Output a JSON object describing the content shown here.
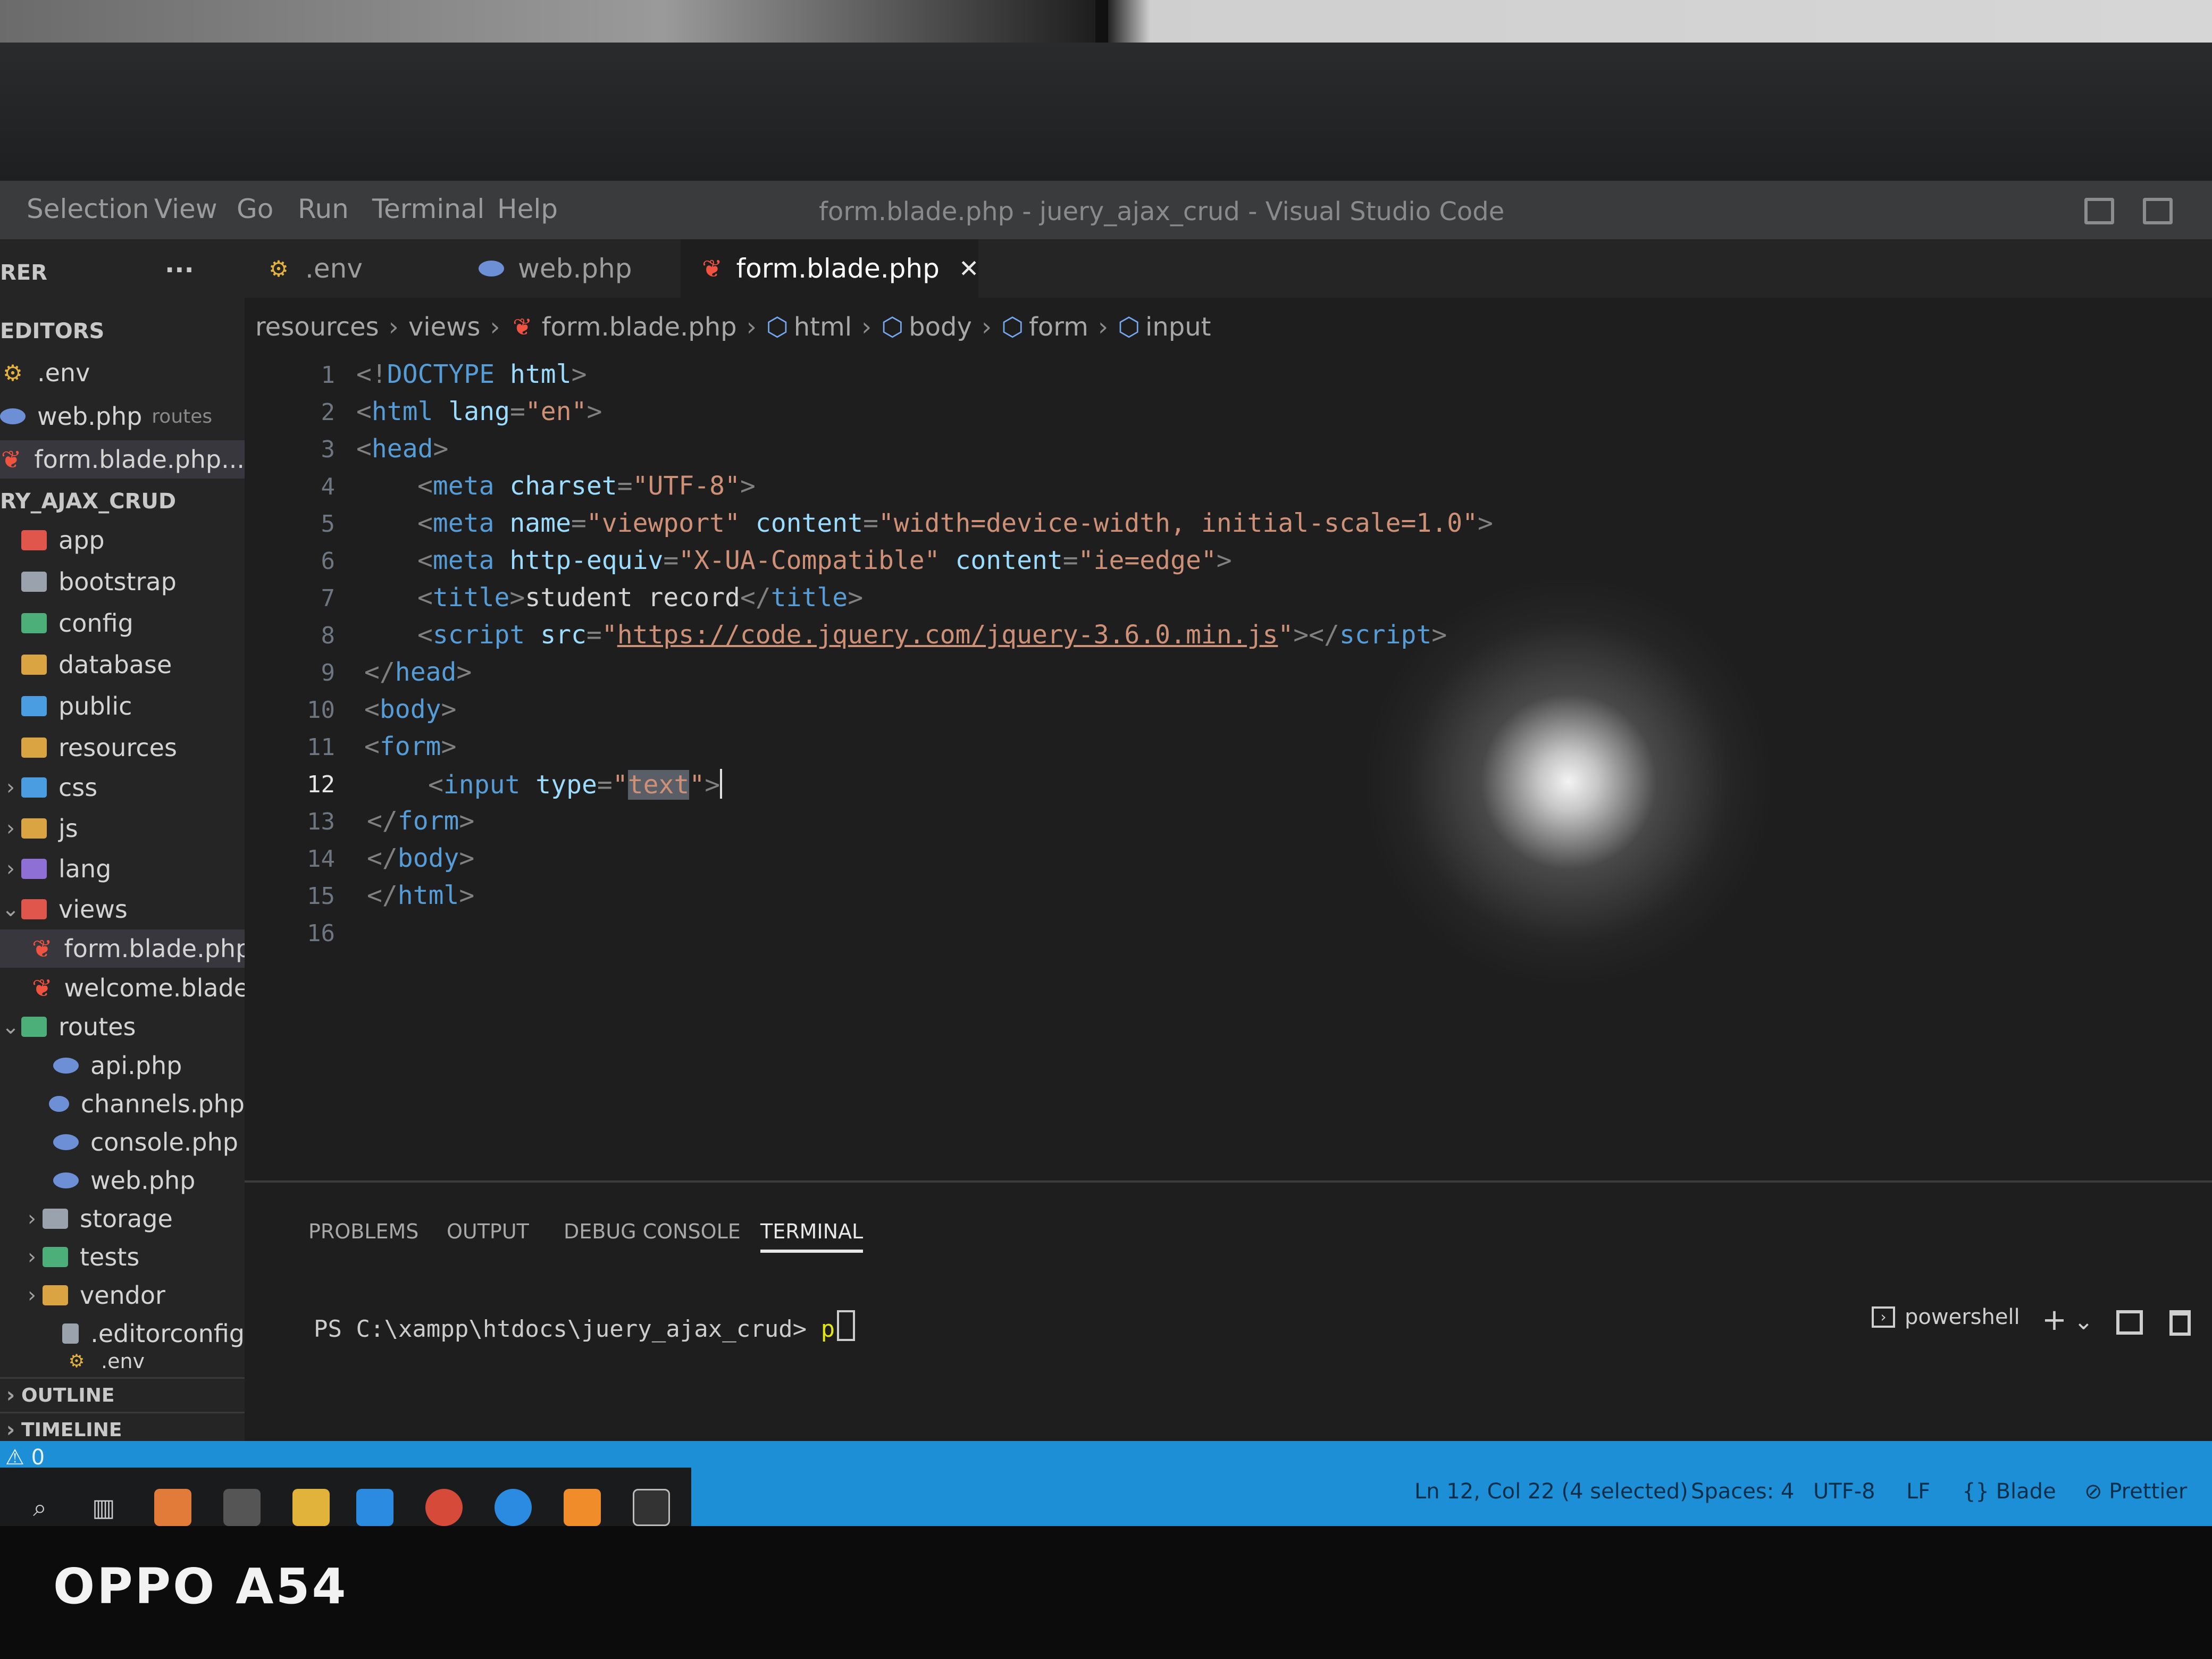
{
  "watermark": "OPPO A54",
  "menu": [
    "Selection",
    "View",
    "Go",
    "Run",
    "Terminal",
    "Help"
  ],
  "window_title": "form.blade.php - juery_ajax_crud - Visual Studio Code",
  "sidebar": {
    "explorer_label": "RER",
    "more": "···",
    "open_editors_label": "EDITORS",
    "open_editors": [
      {
        "name": ".env",
        "detail": ""
      },
      {
        "name": "web.php",
        "detail": "routes"
      },
      {
        "name": "form.blade.php...",
        "detail": ""
      }
    ],
    "project_label": "RY_AJAX_CRUD",
    "tree": [
      {
        "label": "app",
        "chev": ""
      },
      {
        "label": "bootstrap",
        "chev": ""
      },
      {
        "label": "config",
        "chev": ""
      },
      {
        "label": "database",
        "chev": ""
      },
      {
        "label": "public",
        "chev": ""
      },
      {
        "label": "resources",
        "chev": ""
      },
      {
        "label": "css",
        "chev": "›"
      },
      {
        "label": "js",
        "chev": "›"
      },
      {
        "label": "lang",
        "chev": "›"
      },
      {
        "label": "views",
        "chev": "⌄"
      },
      {
        "label": "form.blade.php",
        "chev": ""
      },
      {
        "label": "welcome.blade....",
        "chev": ""
      },
      {
        "label": "routes",
        "chev": "⌄"
      },
      {
        "label": "api.php",
        "chev": ""
      },
      {
        "label": "channels.php",
        "chev": ""
      },
      {
        "label": "console.php",
        "chev": ""
      },
      {
        "label": "web.php",
        "chev": ""
      },
      {
        "label": "storage",
        "chev": "›"
      },
      {
        "label": "tests",
        "chev": "›"
      },
      {
        "label": "vendor",
        "chev": "›"
      },
      {
        "label": ".editorconfig",
        "chev": ""
      },
      {
        "label": ".env",
        "chev": ""
      }
    ],
    "outline_label": "OUTLINE",
    "timeline_label": "TIMELINE"
  },
  "tabs": [
    {
      "label": ".env"
    },
    {
      "label": "web.php"
    },
    {
      "label": "form.blade.php",
      "close": "✕"
    }
  ],
  "breadcrumb": [
    "resources",
    "views",
    "form.blade.php",
    "html",
    "body",
    "form",
    "input"
  ],
  "line_numbers": [
    "1",
    "2",
    "3",
    "4",
    "5",
    "6",
    "7",
    "8",
    "9",
    "10",
    "11",
    "12",
    "13",
    "14",
    "15",
    "16"
  ],
  "code": {
    "l1": {
      "p1": "<!",
      "t1": "DOCTYPE",
      "a1": " html",
      "p2": ">"
    },
    "l2": {
      "p1": "<",
      "t1": "html",
      "a1": " lang",
      "p2": "=",
      "s1": "\"en\"",
      "p3": ">"
    },
    "l3": {
      "p1": "<",
      "t1": "head",
      "p2": ">"
    },
    "l4": {
      "p1": "<",
      "t1": "meta",
      "a1": " charset",
      "p2": "=",
      "s1": "\"UTF-8\"",
      "p3": ">"
    },
    "l5": {
      "p1": "<",
      "t1": "meta",
      "a1": " name",
      "p2": "=",
      "s1": "\"viewport\"",
      "a2": " content",
      "p3": "=",
      "s2": "\"width=device-width, initial-scale=1.0\"",
      "p4": ">"
    },
    "l6": {
      "p1": "<",
      "t1": "meta",
      "a1": " http-equiv",
      "p2": "=",
      "s1": "\"X-UA-Compatible\"",
      "a2": " content",
      "p3": "=",
      "s2": "\"ie=edge\"",
      "p4": ">"
    },
    "l7": {
      "p1": "<",
      "t1": "title",
      "p2": ">",
      "tx": "student record",
      "p3": "</",
      "t2": "title",
      "p4": ">"
    },
    "l8": {
      "p1": "<",
      "t1": "script",
      "a1": " src",
      "p2": "=",
      "q1": "\"",
      "url": "https://code.jquery.com/jquery-3.6.0.min.js",
      "q2": "\"",
      "p3": "></",
      "t2": "script",
      "p4": ">"
    },
    "l9": {
      "p1": "</",
      "t1": "head",
      "p2": ">"
    },
    "l10": {
      "p1": "<",
      "t1": "body",
      "p2": ">"
    },
    "l11": {
      "p1": "<",
      "t1": "form",
      "p2": ">"
    },
    "l12": {
      "p1": "<",
      "t1": "input",
      "a1": " type",
      "p2": "=",
      "q1": "\"",
      "sel": "text",
      "q2": "\"",
      "p3": ">"
    },
    "l13": {
      "p1": "</",
      "t1": "form",
      "p2": ">"
    },
    "l14": {
      "p1": "</",
      "t1": "body",
      "p2": ">"
    },
    "l15": {
      "p1": "</",
      "t1": "html",
      "p2": ">"
    }
  },
  "panel": {
    "tabs": [
      "PROBLEMS",
      "OUTPUT",
      "DEBUG CONSOLE",
      "TERMINAL"
    ],
    "prompt": "PS C:\\xampp\\htdocs\\juery_ajax_crud> ",
    "typed": "p",
    "shell": "powershell",
    "add": "+",
    "dropdown": "⌄"
  },
  "status": {
    "warnings": "⚠ 0",
    "position": "Ln 12, Col 22 (4 selected)",
    "spaces": "Spaces: 4",
    "encoding": "UTF-8",
    "eol": "LF",
    "language": "{} Blade",
    "formatter": "⊘ Prettier"
  },
  "colors": {
    "accent": "#1d8fd6",
    "editor_bg": "#1e1e1e",
    "sidebar_bg": "#252526"
  }
}
